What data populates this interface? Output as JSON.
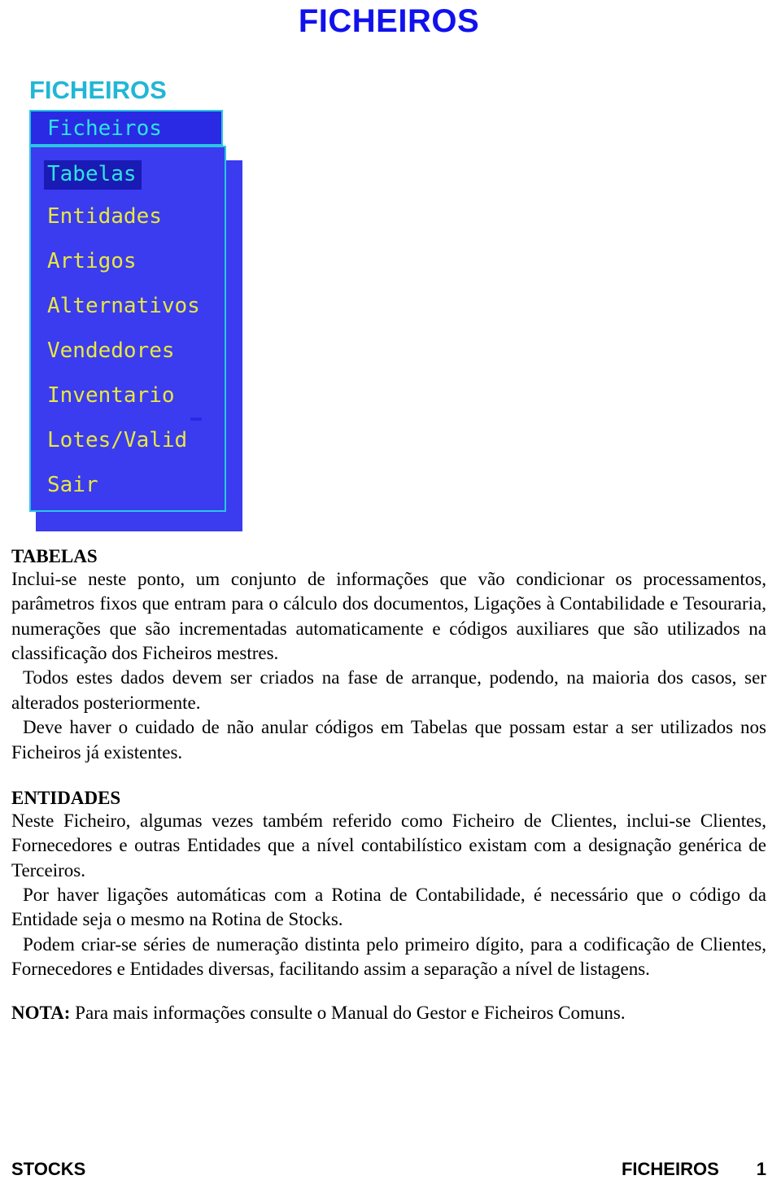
{
  "document": {
    "title": "FICHEIROS",
    "section_heading": "FICHEIROS"
  },
  "screenshot": {
    "window_title": "Ficheiros",
    "menu_items": [
      {
        "label": "Tabelas",
        "selected": true
      },
      {
        "label": "Entidades",
        "selected": false
      },
      {
        "label": "Artigos",
        "selected": false
      },
      {
        "label": "Alternativos",
        "selected": false
      },
      {
        "label": "Vendedores",
        "selected": false
      },
      {
        "label": "Inventario",
        "selected": false
      },
      {
        "label": "Lotes/Valid",
        "selected": false
      },
      {
        "label": "Sair",
        "selected": false
      }
    ],
    "colors": {
      "panel_background": "#3b3bf0",
      "border": "#29c7e0",
      "item_text": "#e8e840",
      "selected_text": "#2fe3e3",
      "selected_background": "#1a1ab4"
    }
  },
  "content": {
    "tabelas": {
      "heading": "TABELAS",
      "paragraph_1": "Inclui-se neste ponto, um conjunto de informações que vão condicionar os processamentos, parâmetros fixos que entram para o cálculo dos documentos, Ligações à Contabilidade e Tesouraria, numerações que são incrementadas automaticamente e códigos auxiliares que são utilizados na classificação dos Ficheiros mestres.",
      "paragraph_2": "Todos estes dados devem ser criados na fase de arranque, podendo, na maioria dos casos, ser alterados posteriormente.",
      "paragraph_3": "Deve haver o cuidado de não anular códigos em Tabelas que possam estar a ser utilizados nos Ficheiros já existentes."
    },
    "entidades": {
      "heading": "ENTIDADES",
      "paragraph_1": "Neste Ficheiro, algumas vezes também referido como Ficheiro de Clientes, inclui-se Clientes, Fornecedores e outras Entidades que a nível contabilístico existam com a designação genérica de Terceiros.",
      "paragraph_2": "Por haver ligações automáticas com a Rotina de Contabilidade, é necessário que o código da Entidade seja o mesmo na Rotina de Stocks.",
      "paragraph_3": "Podem criar-se séries de numeração distinta pelo primeiro dígito, para a codificação de Clientes, Fornecedores e Entidades diversas, facilitando assim a separação a nível de listagens."
    },
    "note": {
      "label": "NOTA:",
      "text": " Para mais informações consulte o Manual do Gestor e Ficheiros Comuns."
    }
  },
  "footer": {
    "left": "STOCKS",
    "section": "FICHEIROS",
    "page_number": "1"
  }
}
